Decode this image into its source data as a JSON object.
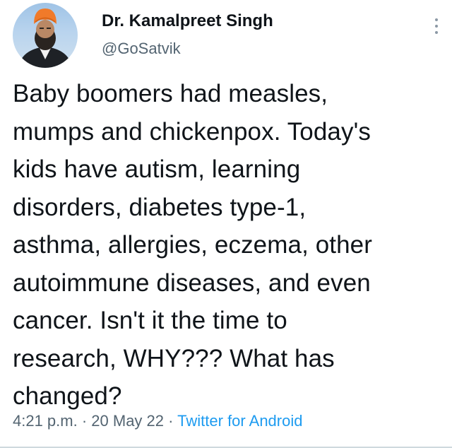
{
  "tweet": {
    "author": {
      "name": "Dr. Kamalpreet Singh",
      "handle": "@GoSatvik"
    },
    "text": "Baby boomers had measles,\nmumps and chickenpox. Today's\nkids have autism, learning\ndisorders, diabetes type-1,\nasthma, allergies, eczema, other\nautoimmune diseases, and even\ncancer. Isn't it the time to\nresearch, WHY??? What has\nchanged?",
    "time": "4:21 p.m.",
    "separator": " · ",
    "date": "20 May 22",
    "source": "Twitter for Android"
  },
  "colors": {
    "text": "#0f1419",
    "secondary": "#536471",
    "link": "#1d9bf0",
    "turban": "#f07a2a"
  },
  "icons": {
    "more": "more-vertical-icon"
  }
}
